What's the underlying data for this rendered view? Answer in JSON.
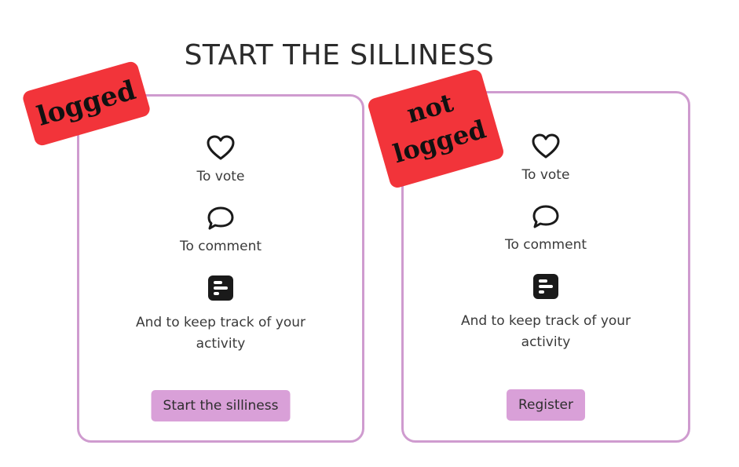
{
  "page": {
    "title": "START THE SILLINESS"
  },
  "cards": [
    {
      "sticker": "logged",
      "items": [
        {
          "icon": "heart-icon",
          "label": "To vote"
        },
        {
          "icon": "speech-bubble-icon",
          "label": "To comment"
        },
        {
          "icon": "activity-icon",
          "label": "And to keep track of your activity"
        }
      ],
      "button_label": "Start the silliness"
    },
    {
      "sticker_line1": "not",
      "sticker_line2": "logged",
      "items": [
        {
          "icon": "heart-icon",
          "label": "To vote"
        },
        {
          "icon": "speech-bubble-icon",
          "label": "To comment"
        },
        {
          "icon": "activity-icon",
          "label": "And to keep track of your activity"
        }
      ],
      "button_label": "Register"
    }
  ],
  "colors": {
    "card_border": "#cf9bcf",
    "button_bg": "#d9a0d8",
    "sticker_bg": "#f2343a"
  }
}
